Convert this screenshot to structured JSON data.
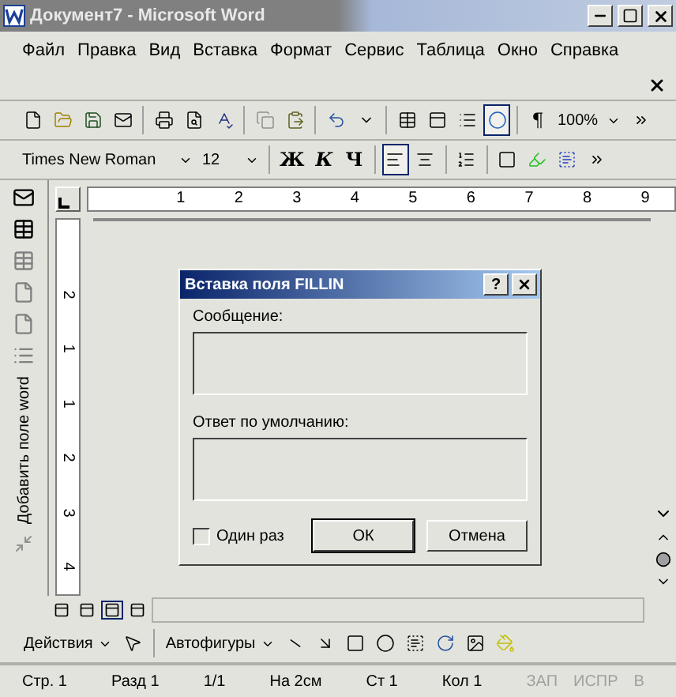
{
  "window": {
    "title": "Документ7 - Microsoft Word"
  },
  "menu": {
    "items": [
      "Файл",
      "Правка",
      "Вид",
      "Вставка",
      "Формат",
      "Сервис",
      "Таблица",
      "Окно",
      "Справка"
    ]
  },
  "standard_toolbar": {
    "zoom": "100%",
    "show_marks": "¶"
  },
  "formatting_toolbar": {
    "font": "Times New Roman",
    "size": "12",
    "bold": "Ж",
    "italic": "К",
    "underline": "Ч",
    "align": [
      {
        "kind": "left",
        "selected": true
      },
      {
        "kind": "center",
        "selected": false
      }
    ]
  },
  "ruler": {
    "labels": [
      "1",
      "2",
      "3",
      "4",
      "5",
      "6",
      "7",
      "8",
      "9"
    ]
  },
  "vertical_ruler": {
    "labels": [
      "2",
      "1",
      "1",
      "2",
      "3",
      "4"
    ]
  },
  "side_toolbar": {
    "caption": "Добавить поле word"
  },
  "dialog": {
    "title": "Вставка поля FILLIN",
    "help": "?",
    "message_label": "Сообщение:",
    "default_label": "Ответ по умолчанию:",
    "once": {
      "label": "Один раз",
      "checked": false
    },
    "buttons": [
      {
        "label": "ОК",
        "default": true
      },
      {
        "label": "Отмена",
        "default": false
      }
    ]
  },
  "view_buttons": [
    {
      "selected": false
    },
    {
      "selected": false
    },
    {
      "selected": true
    },
    {
      "selected": false
    }
  ],
  "drawing_toolbar": {
    "actions": "Действия",
    "autoshapes": "Автофигуры"
  },
  "status_bar": {
    "fields": [
      {
        "text": "Стр. 1",
        "disabled": false
      },
      {
        "text": "Разд 1",
        "disabled": false
      },
      {
        "text": "1/1",
        "disabled": false
      },
      {
        "text": "На 2см",
        "disabled": false
      },
      {
        "text": "Ст 1",
        "disabled": false
      },
      {
        "text": "Кол 1",
        "disabled": false
      },
      {
        "text": "ЗАП",
        "disabled": true
      },
      {
        "text": "ИСПР",
        "disabled": true
      },
      {
        "text": "В",
        "disabled": true
      }
    ]
  }
}
